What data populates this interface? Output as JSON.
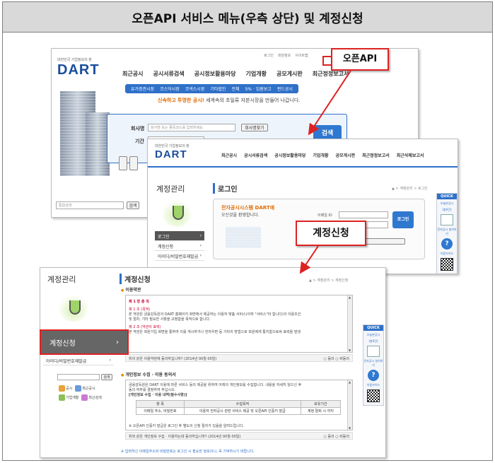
{
  "title": "오픈API 서비스 메뉴(우측 상단) 및 계정신청",
  "callouts": {
    "openapi": "오픈API",
    "account_request": "계정신청"
  },
  "colors": {
    "accent": "#2f70c8",
    "highlight": "#d22222",
    "orange": "#e36a00"
  },
  "screen1": {
    "logo_small": "대한민국 기업정보의 창",
    "logo": "DART",
    "nav": [
      "최근공시",
      "공시서류검색",
      "공시정보활용마당",
      "기업개황",
      "공모게시판",
      "최근정정보고서",
      "최근삭제보고서"
    ],
    "subnav": [
      "유가증권시장",
      "코스닥시장",
      "코넥스시장",
      "기타법인",
      "전체",
      "5% · 임원보고",
      "펀드공시"
    ],
    "slogan_pre": "신속하고",
    "slogan_mid": "투명한 공시!",
    "slogan_post": " 세계속의 초일류 자본시장을 만들어 나갑니다.",
    "label_company": "회사명",
    "placeholder_company": "회사명 또는 종목코드를 입력하세요",
    "btn_company": "회사명찾기",
    "label_period": "기간",
    "search_btn": "검색",
    "bottom_input": "통합검색",
    "bottom_btn": "검색"
  },
  "screen2": {
    "logo_small": "대한민국 기업정보의 창",
    "logo": "DART",
    "nav": [
      "최근공시",
      "공시서류검색",
      "공시정보활용마당",
      "기업개황",
      "공모게시판",
      "최근정정보고서",
      "최근삭제보고서"
    ],
    "side_title": "계정관리",
    "section_title": "로그인",
    "crumb": "▲ > 계정관리 > 로그인",
    "side_items": [
      "로그인",
      "계정신청",
      "아이디/비밀번호재발급"
    ],
    "welcome_line1": "전자공시시스템 DART에",
    "welcome_line2": "오신것을 환영합니다.",
    "id_label": "이메일 ID",
    "login_btn": "로그인"
  },
  "screen3": {
    "side_title": "계정관리",
    "section_title": "계정신청",
    "crumb": "▲ > 계정관리 > 계정신청",
    "side_item_on": "계정신청",
    "side_item_next": "아이디/비밀번호재발급",
    "terms_title": "이용약관",
    "terms_lines": [
      "제 1 장 총 칙",
      "제 1 조 (목적)",
      "본 약관은 금융감독원의 DART 홈페이지 화면에서 제공하는 이용자 맞춤 서비스(이하 \"서비스\"라 합니다)의 이용조건",
      "및 절차, 기타 필요한 사항을 규정함을 목적으로 합니다.",
      "제 2 조 (약관의 효력)",
      "본 약관은 회원가입 화면을 통하여 이를 게시하거나 전자우편 등 기타의 방법으로 회원에게 통지함으로써 효력을 발생"
    ],
    "terms_agree": "위의 같은 이용약관에 동의하십니까? (2014년 00월 00일)",
    "agree_yes": "동의",
    "agree_no": "비동의",
    "privacy_title": "개인정보 수집 · 이용 동의서",
    "privacy_lines": [
      "금융감독원은 DART 이용에 따른 서비스 등의 제공을 위하여 아래의 개인정보를 수집합니다. 내용을 자세히 읽으신 후",
      "동의 여부를 결정하여 주십시오.",
      "[개인정보 수집 · 이용 내역(필수사항)]"
    ],
    "table_headers": [
      "항 목",
      "수집목적",
      "보유기간"
    ],
    "table_row": [
      "이메일 주소, 비밀번호",
      "이용자 전자공시 관련 서비스 제공 및 오픈API 인증키 발급",
      "계정 탈퇴 시 까지"
    ],
    "privacy_note": "※ 오픈API 인증키 발급은 로그인 후 별도의 신청 절차가 있음을 알려드립니다.",
    "privacy_agree": "위와 같은 개인정보 수집 · 이용하는데 동의하십니까? (2014년 00월 00일)",
    "footnote": "※ 입력하신 이메일주소와 비밀번호는 로그인 시 필요한 정보이니, 꼭 기억하시기 바랍니다.",
    "search_btn": "검색",
    "mini_icons": [
      "공시",
      "최근공시",
      "기업개황",
      "최근검색"
    ]
  },
  "quick": {
    "head": "QUICK",
    "items": [
      "오늘본공시",
      "(총0건)",
      "전자공시 설치하기",
      "이용가이드"
    ]
  }
}
